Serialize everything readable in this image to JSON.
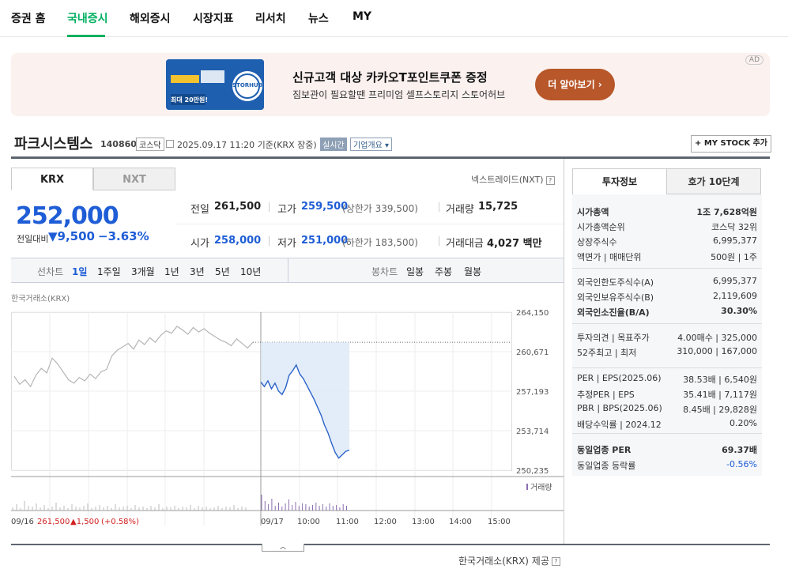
{
  "nav": {
    "items": [
      "증권 홈",
      "국내증시",
      "해외증시",
      "시장지표",
      "리서치",
      "뉴스",
      "MY"
    ],
    "active_index": 1,
    "accent_color": "#00b060"
  },
  "ad": {
    "title": "신규고객 대상 카카오T포인트쿠폰 증정",
    "desc": "짐보관이 필요할땐 프리미엄 셀프스토리지 스토어허브",
    "button": "더 알아보기 ›",
    "badge": "AD",
    "image_text": "최대 20만원!",
    "image_logo": "STORHUB"
  },
  "stock": {
    "name": "파크시스템스",
    "code": "140860",
    "market": "코스닥",
    "date": "2025.09.17 11:20  기준(KRX 장중)",
    "realtime": "실시간",
    "company_info": "기업개요 ▾",
    "mystock": "+ MY STOCK 추가"
  },
  "exchange_tabs": [
    "KRX",
    "NXT"
  ],
  "nxt_link": "넥스트레이드(NXT)",
  "quote": {
    "price": "252,000",
    "change_label": "전일대비",
    "change_arrow": "▼",
    "change": "9,500",
    "change_pct": "−3.63%",
    "prev_label": "전일",
    "prev": "261,500",
    "high_label": "고가",
    "high": "259,500",
    "high_sub": "(상한가 339,500)",
    "volume_label": "거래량",
    "volume": "15,725",
    "open_label": "시가",
    "open": "258,000",
    "low_label": "저가",
    "low": "251,000",
    "low_sub": "(하한가 183,500)",
    "amount_label": "거래대금",
    "amount": "4,027 백만",
    "down_color": "#1e5dd6"
  },
  "period_bar": {
    "line_label": "선차트",
    "line_items": [
      "1일",
      "1주일",
      "3개월",
      "1년",
      "3년",
      "5년",
      "10년"
    ],
    "candle_label": "봉차트",
    "candle_items": [
      "일봉",
      "주봉",
      "월봉"
    ]
  },
  "chart_source": "한국거래소(KRX)",
  "chart_data": {
    "type": "line",
    "title": "",
    "y_ticks": [
      "264,150",
      "260,671",
      "257,193",
      "253,714",
      "250,235"
    ],
    "ylim": [
      250235,
      264150
    ],
    "prev_close": 261500,
    "x_labels": [
      "09/16",
      "09/17",
      "10:00",
      "11:00",
      "12:00",
      "13:00",
      "14:00",
      "15:00"
    ],
    "prev_day_info": {
      "close": "261,500",
      "change": "▲1,500",
      "pct": "(+0.58%)"
    },
    "volume_legend": "거래량",
    "series": [
      {
        "name": "09/16",
        "values": [
          258500,
          257800,
          258200,
          257600,
          258600,
          259200,
          258800,
          260100,
          259600,
          258900,
          258200,
          257900,
          258400,
          258100,
          258700,
          258300,
          258900,
          259100,
          260300,
          260800,
          261100,
          261400,
          260900,
          261700,
          261300,
          261900,
          261500,
          262100,
          262500,
          262300,
          262900,
          262600,
          262200,
          262800,
          262400,
          262700,
          262300,
          262000,
          261700,
          261500,
          261200,
          261800,
          261400,
          261000,
          261500
        ]
      },
      {
        "name": "09/17",
        "values": [
          258000,
          257600,
          258100,
          257400,
          257900,
          257200,
          256900,
          257500,
          258600,
          259000,
          259500,
          258700,
          258300,
          257700,
          257100,
          256500,
          255800,
          255100,
          254200,
          253500,
          252600,
          251800,
          251300,
          251600,
          251900,
          252000
        ]
      }
    ]
  },
  "provider": "한국거래소(KRX) 제공",
  "right_panel": {
    "tabs": [
      "투자정보",
      "호가 10단계"
    ],
    "rows": [
      {
        "label": "시가총액",
        "value": "1조 7,628억원"
      },
      {
        "label": "시가총액순위",
        "value": "코스닥 32위"
      },
      {
        "label": "상장주식수",
        "value": "6,995,377"
      },
      {
        "label": "액면가 | 매매단위",
        "value": "500원 | 1주"
      },
      {
        "label": "외국인한도주식수(A)",
        "value": "6,995,377"
      },
      {
        "label": "외국인보유주식수(B)",
        "value": "2,119,609"
      },
      {
        "label": "외국인소진율(B/A)",
        "value": "30.30%"
      },
      {
        "label": "투자의견 | 목표주가",
        "value": "4.00매수 | 325,000"
      },
      {
        "label": "52주최고 | 최저",
        "value": "310,000 | 167,000"
      },
      {
        "label": "PER | EPS(2025.06)",
        "value": "38.53배 | 6,540원"
      },
      {
        "label": "추정PER | EPS",
        "value": "35.41배 | 7,117원"
      },
      {
        "label": "PBR | BPS(2025.06)",
        "value": "8.45배 | 29,828원"
      },
      {
        "label": "배당수익률 | 2024.12",
        "value": "0.20%"
      },
      {
        "label": "동일업종 PER",
        "value": "69.37배"
      },
      {
        "label": "동일업종 등락률",
        "value": "-0.56%"
      }
    ]
  }
}
